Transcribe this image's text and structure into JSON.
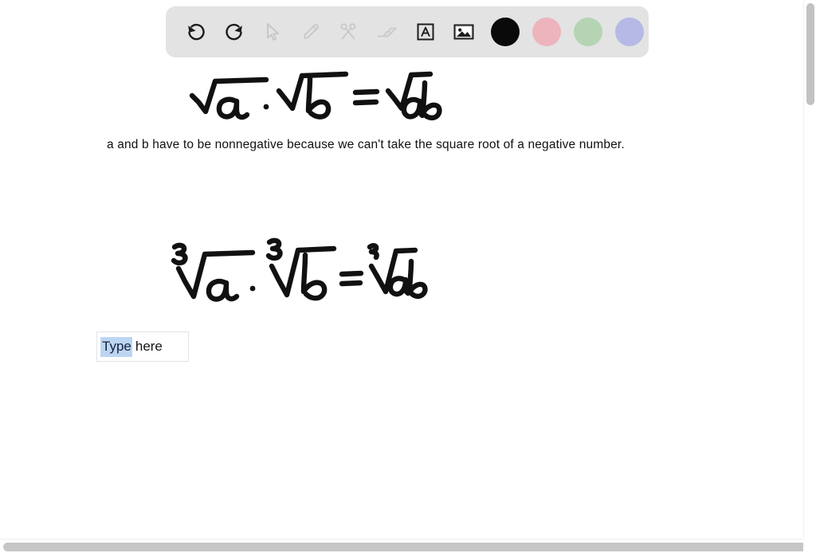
{
  "app": {
    "surface_background": "#ffffff",
    "toolbar_background": "#e3e3e3"
  },
  "toolbar": {
    "name": "drawing-toolbar",
    "tools": [
      {
        "id": "undo",
        "icon": "undo-icon",
        "label": "Undo",
        "enabled": true
      },
      {
        "id": "redo",
        "icon": "redo-icon",
        "label": "Redo",
        "enabled": true
      },
      {
        "id": "select",
        "icon": "cursor-icon",
        "label": "Select",
        "enabled": false
      },
      {
        "id": "pencil",
        "icon": "pencil-icon",
        "label": "Pencil",
        "enabled": false
      },
      {
        "id": "cut",
        "icon": "scissors-icon",
        "label": "Cut",
        "enabled": false
      },
      {
        "id": "erase",
        "icon": "eraser-icon",
        "label": "Eraser",
        "enabled": false
      },
      {
        "id": "text",
        "icon": "text-box-icon",
        "label": "Text",
        "enabled": true
      },
      {
        "id": "image",
        "icon": "image-icon",
        "label": "Insert image",
        "enabled": true
      }
    ],
    "colors": [
      {
        "id": "black",
        "name": "color-swatch-black",
        "hex": "#0a0a0a"
      },
      {
        "id": "pink",
        "name": "color-swatch-pink",
        "hex": "#edb4bd"
      },
      {
        "id": "green",
        "name": "color-swatch-green",
        "hex": "#b5d4b3"
      },
      {
        "id": "purple",
        "name": "color-swatch-purple",
        "hex": "#b6b8e6"
      }
    ]
  },
  "canvas": {
    "equations": [
      {
        "id": "square-root-product-rule",
        "plain": "sqrt(a) * sqrt(b) = sqrt(ab)",
        "index": "",
        "description": "Handwritten square root product rule"
      },
      {
        "id": "cube-root-product-rule",
        "plain": "cbrt(a) * cbrt(b) = cbrt(ab)",
        "index": "3",
        "description": "Handwritten cube root product rule"
      }
    ],
    "note": "a and b have to be nonnegative because we can't take the square root of a negative number.",
    "textbox": {
      "selected_text": "Type",
      "trailing_text": "here",
      "full_value": "Type here",
      "selection_color": "#bcd6f2"
    }
  },
  "scrollbars": {
    "vertical": {
      "name": "vertical-scrollbar",
      "thumb_color": "#c2c2c2"
    },
    "horizontal": {
      "name": "horizontal-scrollbar",
      "thumb_color": "#c6c6c6"
    }
  }
}
